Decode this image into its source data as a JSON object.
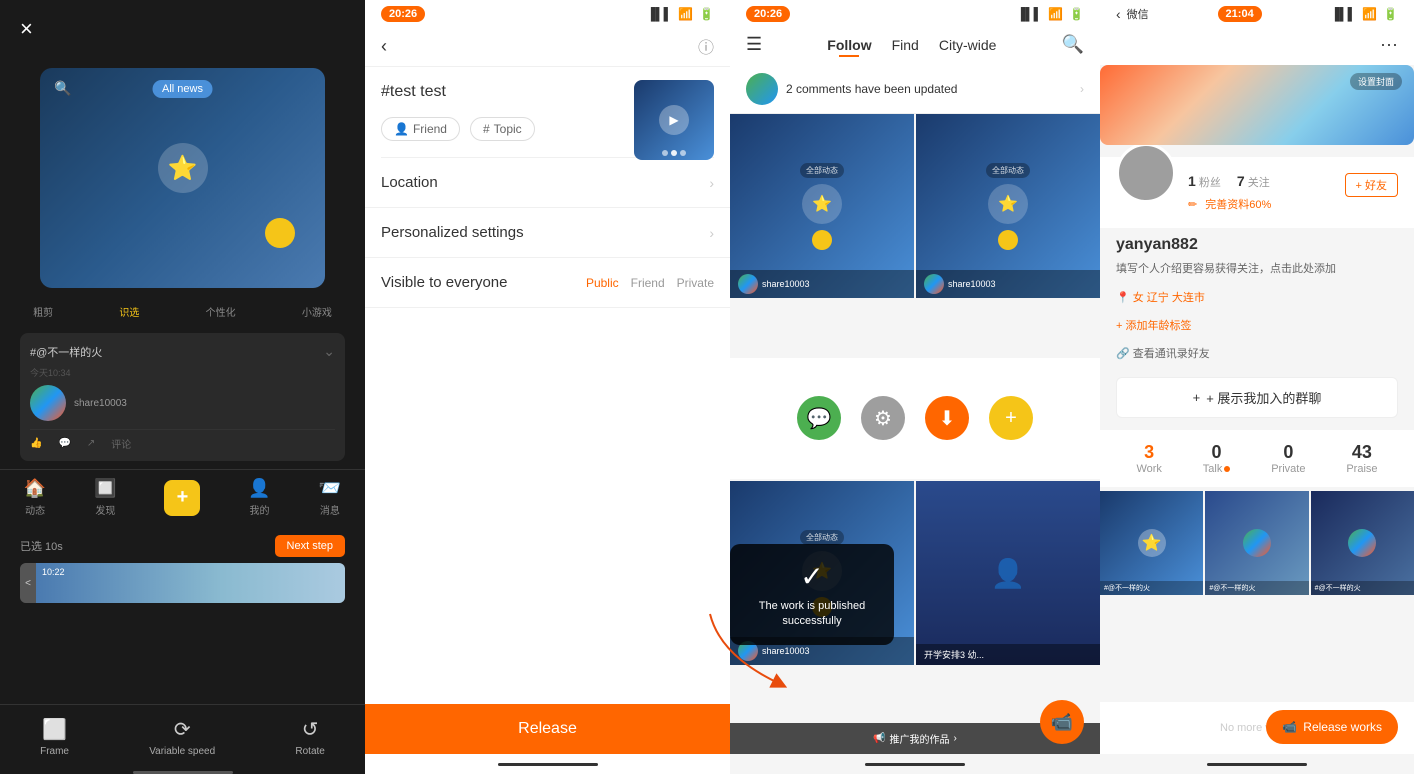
{
  "panel1": {
    "close_label": "×",
    "all_news": "All news",
    "tabs": [
      "粗剪",
      "识选",
      "个性化",
      "小游戏"
    ],
    "feed": {
      "title": "#@不一样的火",
      "time": "今天10:34",
      "avatar_name": "share10003",
      "selected": "已选 10s"
    },
    "next_step": "Next step",
    "footer_items": [
      {
        "label": "Frame",
        "icon": "⬜"
      },
      {
        "label": "Variable speed",
        "icon": "⟳"
      },
      {
        "label": "Rotate",
        "icon": "↺"
      }
    ]
  },
  "panel2": {
    "status_time": "20:26",
    "hashtag": "#test test",
    "tags": [
      {
        "label": "Friend",
        "icon": "👤"
      },
      {
        "label": "Topic",
        "icon": "#"
      }
    ],
    "rows": [
      {
        "label": "Location",
        "has_chevron": true
      },
      {
        "label": "Personalized settings",
        "has_chevron": true
      },
      {
        "label": "Visible to everyone",
        "options": [
          "Public",
          "Friend",
          "Private"
        ],
        "active": "Public"
      }
    ],
    "release_label": "Release"
  },
  "panel3": {
    "status_time": "20:26",
    "nav_tabs": [
      "Follow",
      "Find",
      "City-wide"
    ],
    "active_tab": "Follow",
    "notification": "2 comments have been updated",
    "success_message": "The work is published successfully",
    "recommend": "推广我的作品",
    "camera_icon": "📹"
  },
  "panel4": {
    "status_time": "21:04",
    "wechat": "微信",
    "settings_label": "设置封面",
    "username": "yanyan882",
    "bio": "填写个人介绍更容易获得关注，点击此处添加",
    "stats": {
      "followers": "1",
      "followers_label": "粉丝",
      "following": "7",
      "following_label": "关注"
    },
    "profile_complete": "完善资料60%",
    "add_friend": "+ 好友",
    "tags": [
      {
        "label": "女  辽宁 大连市",
        "type": "location"
      },
      {
        "label": "+ 添加年龄标签",
        "type": "plus"
      },
      {
        "label": "查看通讯录好友",
        "type": "link"
      }
    ],
    "group_btn": "+ 展示我加入的群聊",
    "work_counts": [
      {
        "num": "3",
        "label": "Work",
        "orange": true
      },
      {
        "num": "0",
        "label": "Talk",
        "dot": true
      },
      {
        "num": "0",
        "label": "Private"
      },
      {
        "num": "43",
        "label": "Praise"
      }
    ],
    "no_more": "No more works",
    "release_works": "Release works"
  }
}
